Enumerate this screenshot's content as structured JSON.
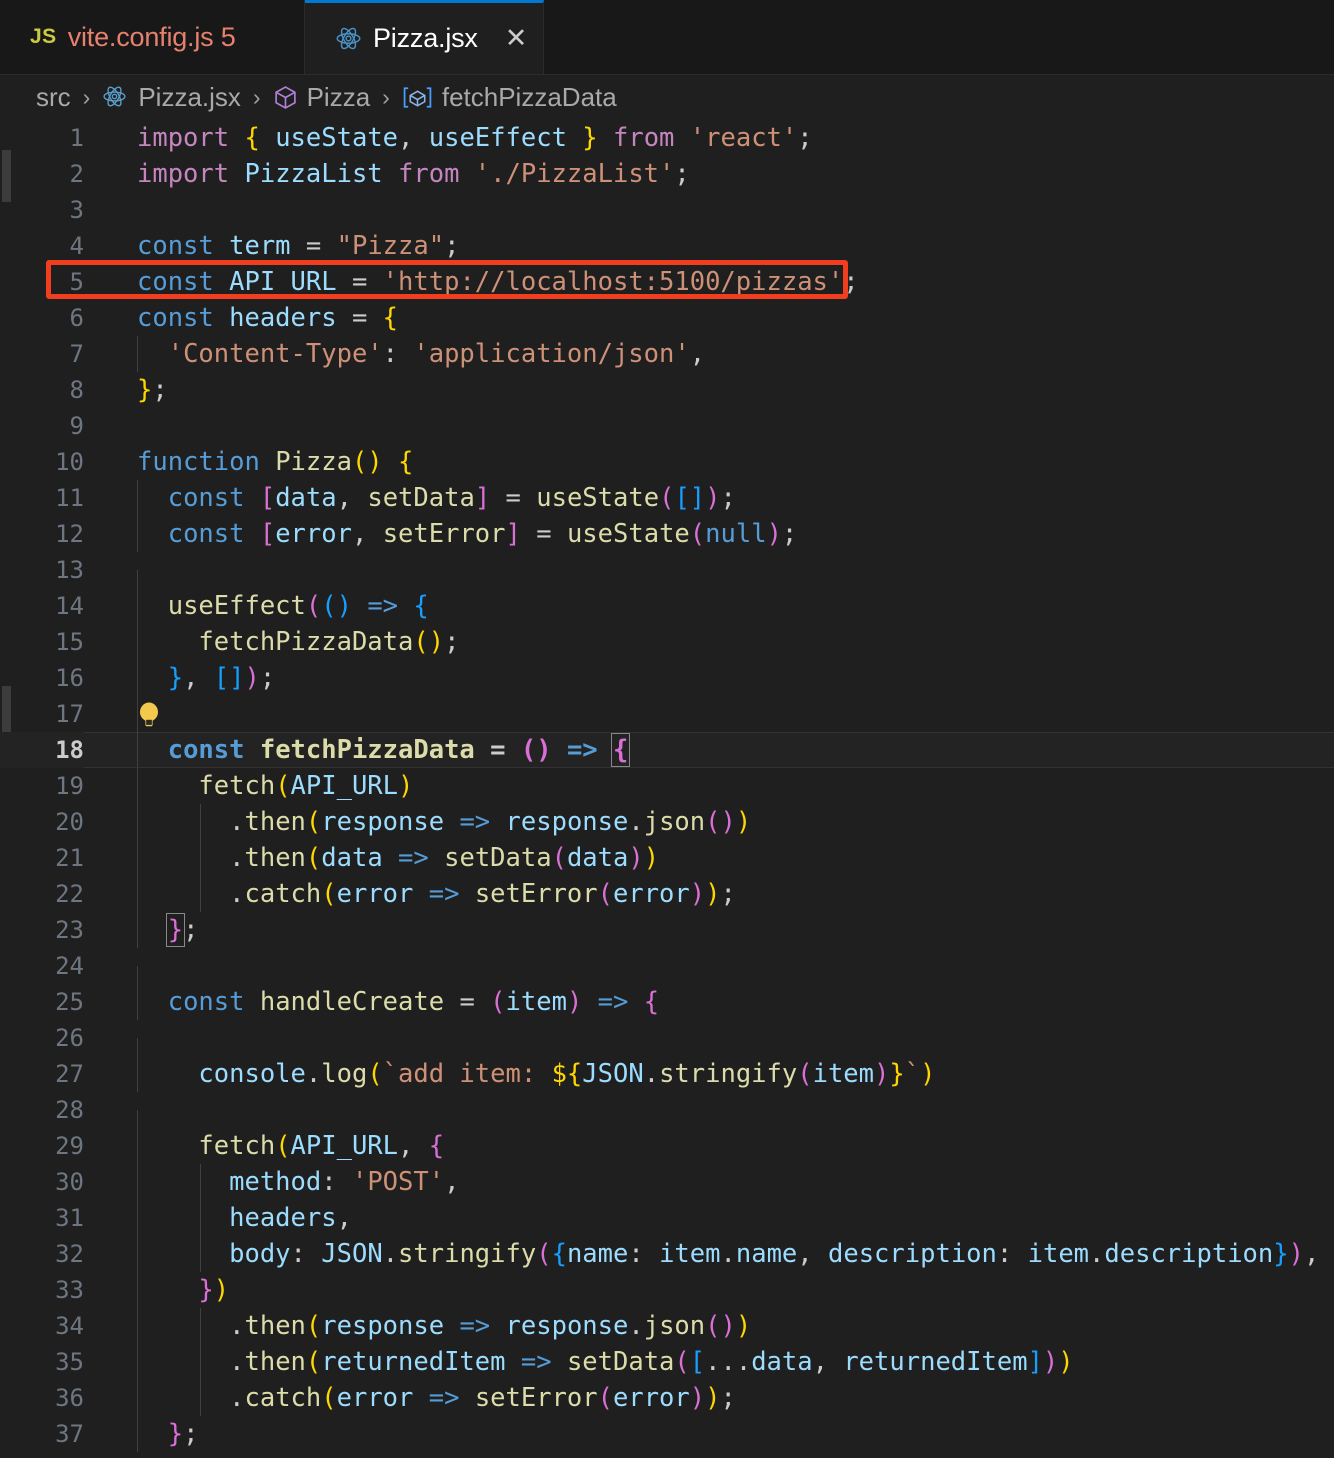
{
  "window": {
    "app": "Visual Studio Code",
    "theme_background": "#1f1f1f",
    "accent": "#0078d4",
    "annotation_color": "#f03e1e"
  },
  "tabs": [
    {
      "label": "vite.config.js 5",
      "filename": "vite.config.js",
      "problem_count": "5",
      "icon": "js-file-icon",
      "active": false,
      "closable": false
    },
    {
      "label": "Pizza.jsx",
      "filename": "Pizza.jsx",
      "icon": "react-file-icon",
      "active": true,
      "closable": true,
      "close_glyph": "✕"
    }
  ],
  "breadcrumb": {
    "separator": "›",
    "items": [
      {
        "label": "src",
        "icon": "none"
      },
      {
        "label": "Pizza.jsx",
        "icon": "react-file-icon"
      },
      {
        "label": "Pizza",
        "icon": "class-cube-icon"
      },
      {
        "label": "fetchPizzaData",
        "icon": "method-icon"
      }
    ]
  },
  "annotation": {
    "type": "red-rectangle-highlight",
    "target_line": "5",
    "target_text": "const API_URL = 'http://localhost:5100/pizzas';",
    "color": "#f03e1e"
  },
  "editor": {
    "language": "javascriptreact",
    "current_line": "18",
    "quick_fix_line": "17",
    "quick_fix_icon": "lightbulb-icon",
    "first_visible_line": 1,
    "last_visible_line": 37,
    "lines": [
      {
        "n": "1",
        "text": "import { useState, useEffect } from 'react';"
      },
      {
        "n": "2",
        "text": "import PizzaList from './PizzaList';"
      },
      {
        "n": "3",
        "text": ""
      },
      {
        "n": "4",
        "text": "const term = \"Pizza\";"
      },
      {
        "n": "5",
        "text": "const API_URL = 'http://localhost:5100/pizzas';"
      },
      {
        "n": "6",
        "text": "const headers = {"
      },
      {
        "n": "7",
        "text": "  'Content-Type': 'application/json',"
      },
      {
        "n": "8",
        "text": "};"
      },
      {
        "n": "9",
        "text": ""
      },
      {
        "n": "10",
        "text": "function Pizza() {"
      },
      {
        "n": "11",
        "text": "  const [data, setData] = useState([]);"
      },
      {
        "n": "12",
        "text": "  const [error, setError] = useState(null);"
      },
      {
        "n": "13",
        "text": ""
      },
      {
        "n": "14",
        "text": "  useEffect(() => {"
      },
      {
        "n": "15",
        "text": "    fetchPizzaData();"
      },
      {
        "n": "16",
        "text": "  }, []);"
      },
      {
        "n": "17",
        "text": ""
      },
      {
        "n": "18",
        "text": "  const fetchPizzaData = () => {"
      },
      {
        "n": "19",
        "text": "    fetch(API_URL)"
      },
      {
        "n": "20",
        "text": "      .then(response => response.json())"
      },
      {
        "n": "21",
        "text": "      .then(data => setData(data))"
      },
      {
        "n": "22",
        "text": "      .catch(error => setError(error));"
      },
      {
        "n": "23",
        "text": "  };"
      },
      {
        "n": "24",
        "text": ""
      },
      {
        "n": "25",
        "text": "  const handleCreate = (item) => {"
      },
      {
        "n": "26",
        "text": ""
      },
      {
        "n": "27",
        "text": "    console.log(`add item: ${JSON.stringify(item)}`)"
      },
      {
        "n": "28",
        "text": ""
      },
      {
        "n": "29",
        "text": "    fetch(API_URL, {"
      },
      {
        "n": "30",
        "text": "      method: 'POST',"
      },
      {
        "n": "31",
        "text": "      headers,"
      },
      {
        "n": "32",
        "text": "      body: JSON.stringify({name: item.name, description: item.description}),"
      },
      {
        "n": "33",
        "text": "    })"
      },
      {
        "n": "34",
        "text": "      .then(response => response.json())"
      },
      {
        "n": "35",
        "text": "      .then(returnedItem => setData([...data, returnedItem]))"
      },
      {
        "n": "36",
        "text": "      .catch(error => setError(error));"
      },
      {
        "n": "37",
        "text": "  };"
      }
    ]
  }
}
